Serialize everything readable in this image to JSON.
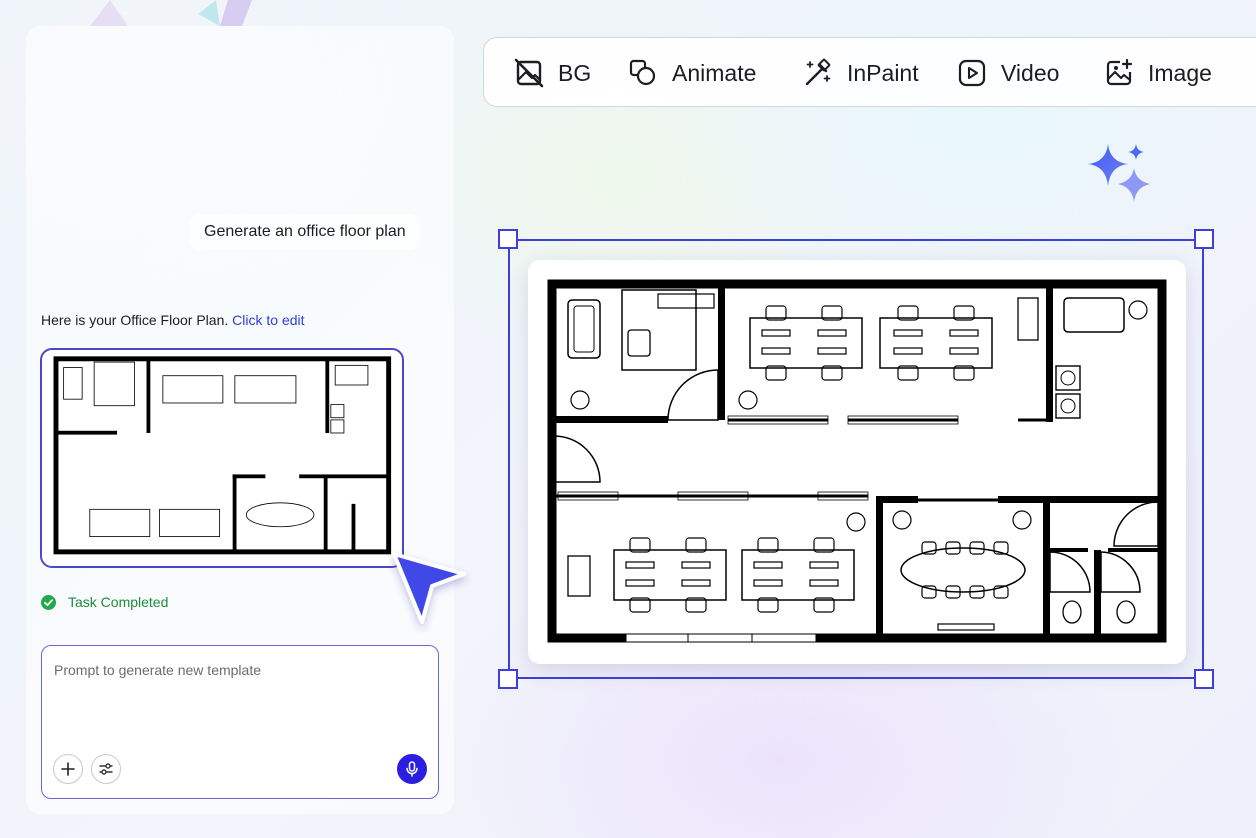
{
  "chat": {
    "user_message": "Generate an office floor plan",
    "reply_prefix": "Here is your Office Floor Plan.",
    "reply_link": "Click to edit",
    "status": "Task Completed"
  },
  "prompt": {
    "placeholder": "Prompt to generate new template"
  },
  "toolbar": {
    "items": [
      {
        "label": "BG",
        "icon": "bg-remove-icon"
      },
      {
        "label": "Animate",
        "icon": "animate-icon"
      },
      {
        "label": "InPaint",
        "icon": "magic-wand-icon"
      },
      {
        "label": "Video",
        "icon": "video-play-icon"
      },
      {
        "label": "Image",
        "icon": "image-add-icon"
      }
    ]
  },
  "colors": {
    "accent": "#3d3fd8",
    "mic_button": "#2a1fe0",
    "success": "#22a94a",
    "link": "#2e3fd6",
    "sparkle": "#4a6bf0"
  }
}
